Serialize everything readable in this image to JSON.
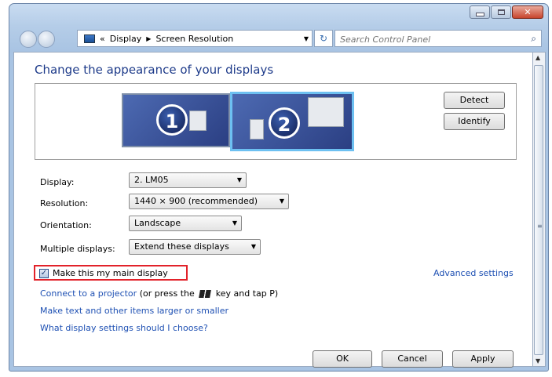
{
  "window": {
    "buttons": [
      "minimize",
      "maximize",
      "close"
    ]
  },
  "nav": {
    "address": {
      "crumb_prefix": "«",
      "crumbs": [
        "Display",
        "Screen Resolution"
      ]
    },
    "search_placeholder": "Search Control Panel"
  },
  "main": {
    "heading": "Change the appearance of your displays",
    "monitors": [
      {
        "number": "1",
        "selected": false
      },
      {
        "number": "2",
        "selected": true
      }
    ],
    "detect_label": "Detect",
    "identify_label": "Identify",
    "fields": {
      "display": {
        "label": "Display:",
        "value": "2. LM05"
      },
      "resolution": {
        "label": "Resolution:",
        "value": "1440 × 900 (recommended)"
      },
      "orientation": {
        "label": "Orientation:",
        "value": "Landscape"
      },
      "multiple": {
        "label": "Multiple displays:",
        "value": "Extend these displays"
      }
    },
    "main_display": {
      "label": "Make this my main display",
      "checked": true
    },
    "advanced_link": "Advanced settings",
    "projector_link": "Connect to a projector",
    "projector_text_pre": "(or press the",
    "projector_text_post": "key and tap P)",
    "larger_link": "Make text and other items larger or smaller",
    "help_link": "What display settings should I choose?",
    "ok_label": "OK",
    "cancel_label": "Cancel",
    "apply_label": "Apply"
  },
  "colors": {
    "link": "#1e50b3",
    "heading": "#1e3b8a",
    "highlight": "#e2222a"
  }
}
